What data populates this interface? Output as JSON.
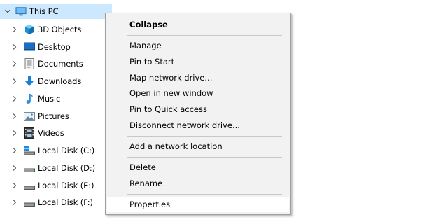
{
  "tree": {
    "root": {
      "label": "This PC",
      "icon": "monitor-icon",
      "expanded": true
    },
    "items": [
      {
        "label": "3D Objects",
        "icon": "cube-3d-icon"
      },
      {
        "label": "Desktop",
        "icon": "desktop-icon"
      },
      {
        "label": "Documents",
        "icon": "documents-icon"
      },
      {
        "label": "Downloads",
        "icon": "download-arrow-icon"
      },
      {
        "label": "Music",
        "icon": "music-note-icon"
      },
      {
        "label": "Pictures",
        "icon": "pictures-icon"
      },
      {
        "label": "Videos",
        "icon": "film-icon"
      },
      {
        "label": "Local Disk (C:)",
        "icon": "windows-drive-icon"
      },
      {
        "label": "Local Disk (D:)",
        "icon": "drive-icon"
      },
      {
        "label": "Local Disk (E:)",
        "icon": "drive-icon"
      },
      {
        "label": "Local Disk (F:)",
        "icon": "drive-icon"
      }
    ]
  },
  "context_menu": {
    "groups": [
      [
        {
          "label": "Collapse",
          "bold": true
        }
      ],
      [
        {
          "label": "Manage"
        },
        {
          "label": "Pin to Start"
        },
        {
          "label": "Map network drive..."
        },
        {
          "label": "Open in new window"
        },
        {
          "label": "Pin to Quick access"
        },
        {
          "label": "Disconnect network drive..."
        }
      ],
      [
        {
          "label": "Add a network location"
        }
      ],
      [
        {
          "label": "Delete"
        },
        {
          "label": "Rename"
        }
      ],
      [
        {
          "label": "Properties",
          "hovered": true
        }
      ]
    ]
  },
  "colors": {
    "selection": "#cce8ff",
    "menu_background": "#f2f2f2",
    "menu_hover": "#ffffff",
    "separator": "#c8c8c8"
  }
}
